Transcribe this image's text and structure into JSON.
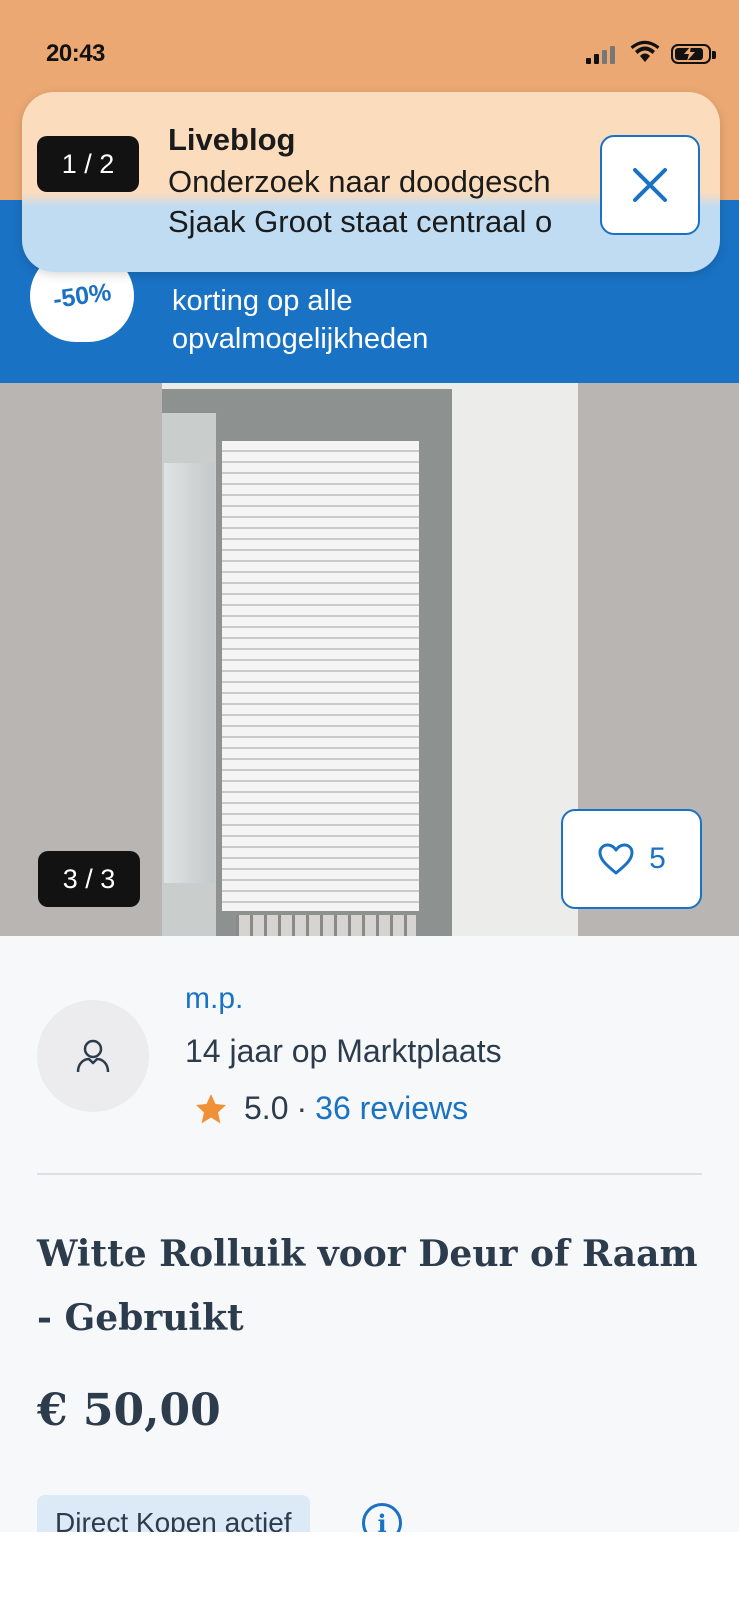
{
  "status_bar": {
    "time": "20:43",
    "icons": [
      "signal-icon",
      "wifi-icon",
      "battery-charging-icon"
    ]
  },
  "promo": {
    "badge": "-50%",
    "text_line1": "korting op alle",
    "text_line2": "opvalmogelijkheden",
    "colors": {
      "background": "#1a72c4"
    }
  },
  "notification": {
    "counter": "1 / 2",
    "title": "Liveblog",
    "line1": "Onderzoek naar doodgesch",
    "line2": "Sjaak Groot staat centraal o",
    "close_icon": "close-icon"
  },
  "gallery": {
    "counter": "3 / 3",
    "favorites_count": "5",
    "favorite_icon": "heart-icon"
  },
  "seller": {
    "name": "m.p.",
    "member_since": "14 jaar op Marktplaats",
    "rating": "5.0",
    "separator": "·",
    "reviews": "36 reviews",
    "avatar_icon": "user-icon",
    "star_icon": "star-icon"
  },
  "listing": {
    "title": "Witte Rolluik voor Deur of Raam - Gebruikt",
    "price": "€ 50,00",
    "direct_kopen": "Direct Kopen actief",
    "info_icon": "info-icon"
  },
  "colors": {
    "accent": "#1a72c4",
    "status_bar": "#eba873",
    "star": "#f0913a",
    "text": "#2d3c4d"
  }
}
